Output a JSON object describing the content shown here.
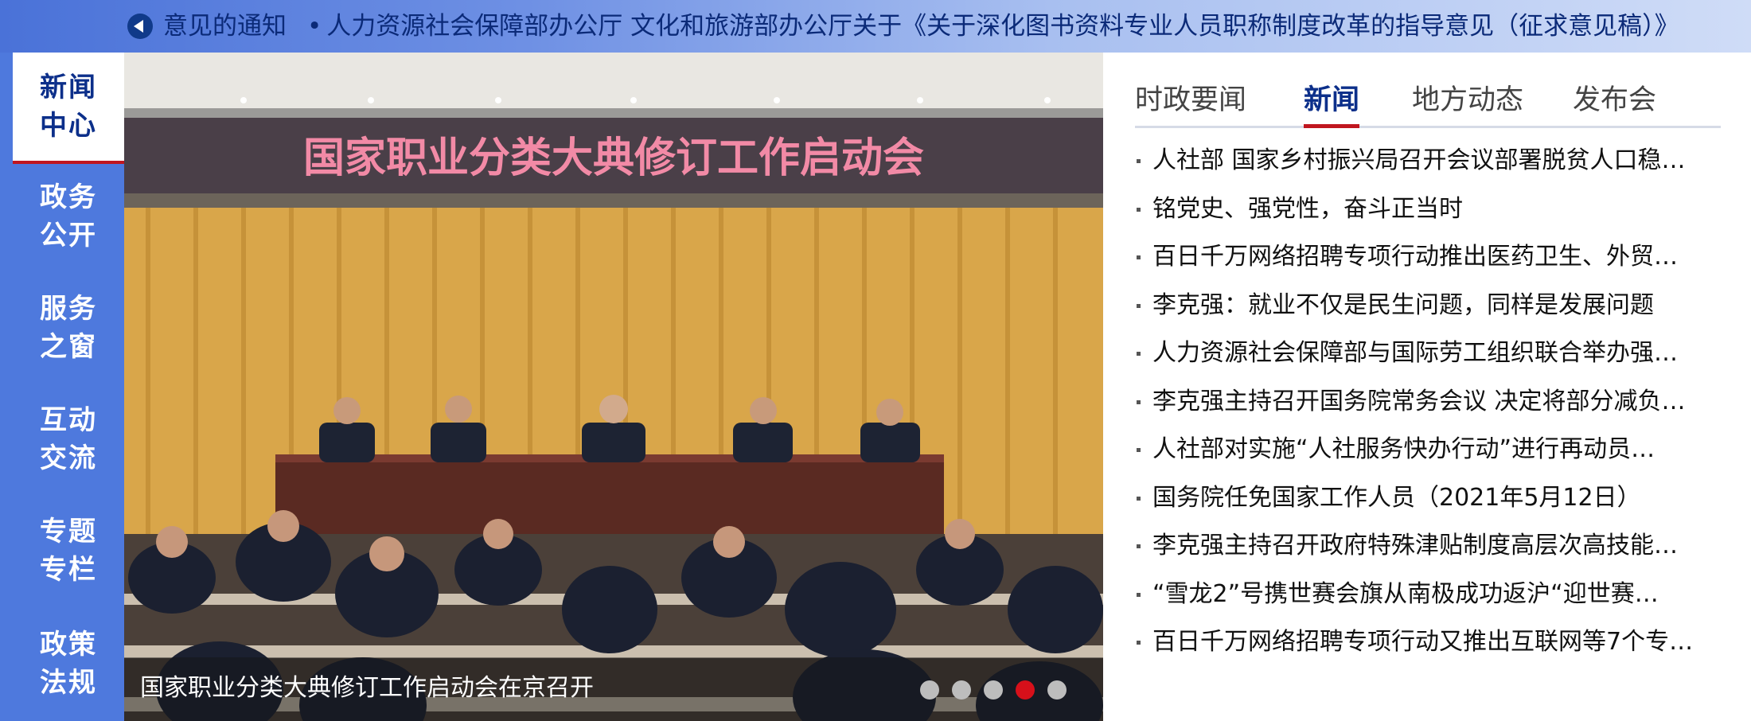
{
  "ticker": {
    "text_left": "意见的通知",
    "text_main": "人力资源社会保障部办公厅 文化和旅游部办公厅关于《关于深化图书资料专业人员职称制度改革的指导意见（征求意见稿）》"
  },
  "sidenav": {
    "items": [
      {
        "line1": "新闻",
        "line2": "中心"
      },
      {
        "line1": "政务",
        "line2": "公开"
      },
      {
        "line1": "服务",
        "line2": "之窗"
      },
      {
        "line1": "互动",
        "line2": "交流"
      },
      {
        "line1": "专题",
        "line2": "专栏"
      },
      {
        "line1": "政策",
        "line2": "法规"
      }
    ]
  },
  "carousel": {
    "banner_text": "国家职业分类大典修订工作启动会",
    "caption": "国家职业分类大典修订工作启动会在京召开",
    "dot_count": 5,
    "active_dot": 4
  },
  "news": {
    "tabs": [
      "时政要闻",
      "新闻",
      "地方动态",
      "发布会"
    ],
    "items": [
      "人社部 国家乡村振兴局召开会议部署脱贫人口稳…",
      "铭党史、强党性，奋斗正当时",
      "百日千万网络招聘专项行动推出医药卫生、外贸…",
      "李克强：就业不仅是民生问题，同样是发展问题",
      "人力资源社会保障部与国际劳工组织联合举办强…",
      "李克强主持召开国务院常务会议 决定将部分减负…",
      "人社部对实施“人社服务快办行动”进行再动员…",
      "国务院任免国家工作人员（2021年5月12日）",
      "李克强主持召开政府特殊津贴制度高层次高技能…",
      "“雪龙2”号携世赛会旗从南极成功返沪“迎世赛…",
      "百日千万网络招聘专项行动又推出互联网等7个专…"
    ]
  },
  "colors": {
    "nav_bg": "#4e79dd",
    "brand_blue": "#0c2f8a",
    "accent_red": "#c0161f"
  }
}
